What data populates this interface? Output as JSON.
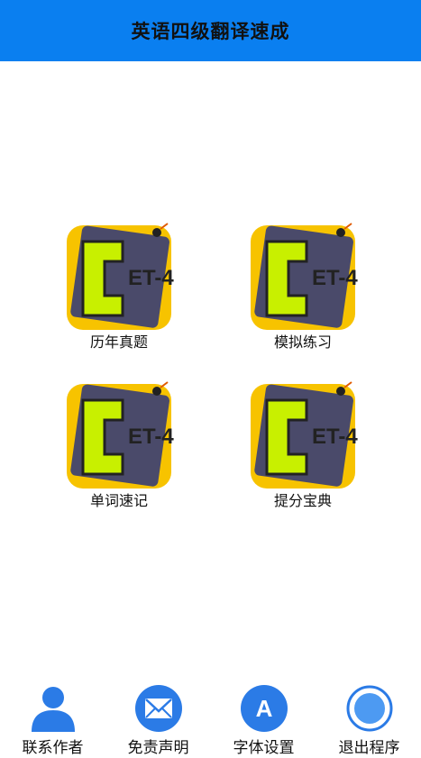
{
  "header": {
    "title": "英语四级翻译速成",
    "color": "#0a7ff0"
  },
  "menu": {
    "items": [
      {
        "label": "历年真题",
        "icon": "cet4-logo-icon"
      },
      {
        "label": "模拟练习",
        "icon": "cet4-logo-icon"
      },
      {
        "label": "单词速记",
        "icon": "cet4-logo-icon"
      },
      {
        "label": "提分宝典",
        "icon": "cet4-logo-icon"
      }
    ],
    "logo_text": "ET-4"
  },
  "bottom_nav": {
    "items": [
      {
        "label": "联系作者",
        "icon": "person-icon"
      },
      {
        "label": "免责声明",
        "icon": "mail-icon"
      },
      {
        "label": "字体设置",
        "icon": "font-a-icon",
        "glyph": "A"
      },
      {
        "label": "退出程序",
        "icon": "power-circle-icon"
      }
    ]
  }
}
